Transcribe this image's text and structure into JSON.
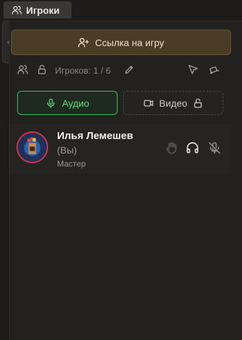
{
  "tab": {
    "label": "Игроки",
    "icon": "users-icon"
  },
  "panel": {
    "invite_label": "Ссылка на игру",
    "invite_icon": "user-plus-icon"
  },
  "toolbar": {
    "players_text": "Игроков: 1 / 6",
    "icons": [
      "users-icon",
      "lock-icon",
      "pencil-icon",
      "cursor-icon",
      "camera-icon"
    ]
  },
  "media": {
    "audio_label": "Аудио",
    "video_label": "Видео",
    "audio_active_color": "#3ec45a"
  },
  "player": {
    "name": "Илья Лемешев",
    "you_label": "(Вы)",
    "role": "Мастер",
    "avatar_ring_color": "#d4344a"
  },
  "colors": {
    "background": "#1d1c1b",
    "invite_bg": "#4a3c26",
    "accent_green": "#5ee07a"
  }
}
